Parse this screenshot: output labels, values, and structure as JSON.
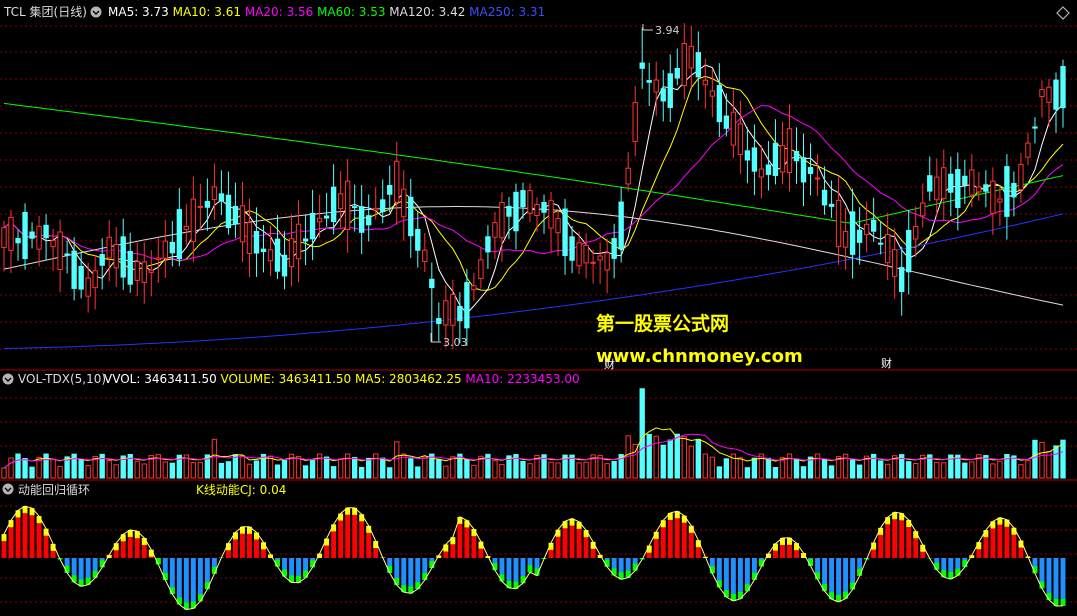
{
  "main_panel": {
    "title": "TCL 集团(日线)",
    "indicators": [
      {
        "label": "MA5: 3.73",
        "color": "#ffffff"
      },
      {
        "label": "MA10: 3.61",
        "color": "#ffff00"
      },
      {
        "label": "MA20: 3.56",
        "color": "#ff00ff"
      },
      {
        "label": "MA60: 3.53",
        "color": "#00ff00"
      },
      {
        "label": "MA120: 3.42",
        "color": "#dcdcdc"
      },
      {
        "label": "MA250: 3.31",
        "color": "#3a4dff"
      }
    ],
    "high_label": "3.94",
    "low_label": "3.03"
  },
  "volume_panel": {
    "title": "VOL-TDX(5,10)",
    "indicators": [
      {
        "label": "VVOL: 3463411.50",
        "color": "#ffffff"
      },
      {
        "label": "VOLUME: 3463411.50",
        "color": "#ffff00"
      },
      {
        "label": "MA5: 2803462.25",
        "color": "#ffff00"
      },
      {
        "label": "MA10: 2233453.00",
        "color": "#ff00ff"
      }
    ]
  },
  "momentum_panel": {
    "title": "动能回归循环",
    "indicator": "K线动能CJ: 0.04"
  },
  "watermark": {
    "line1": "第一股票公式网",
    "line2": "www.chnmoney.com"
  },
  "markers": {
    "fin1": "财",
    "fin2": "财"
  },
  "colors": {
    "up": "#ff3232",
    "down": "#54ffff",
    "grid": "#8b0000",
    "background": "#000000",
    "ma5": "#ffffff",
    "ma10": "#ffff00",
    "ma20": "#ff00ff",
    "ma60": "#00ff00",
    "ma120": "#dcdcdc",
    "ma250": "#2233ff",
    "momentum_up": "#ff0000",
    "momentum_up_tip": "#ffff00",
    "momentum_down": "#1e90ff",
    "momentum_down_tip": "#00ff00",
    "momentum_line": "#ffff80"
  }
}
